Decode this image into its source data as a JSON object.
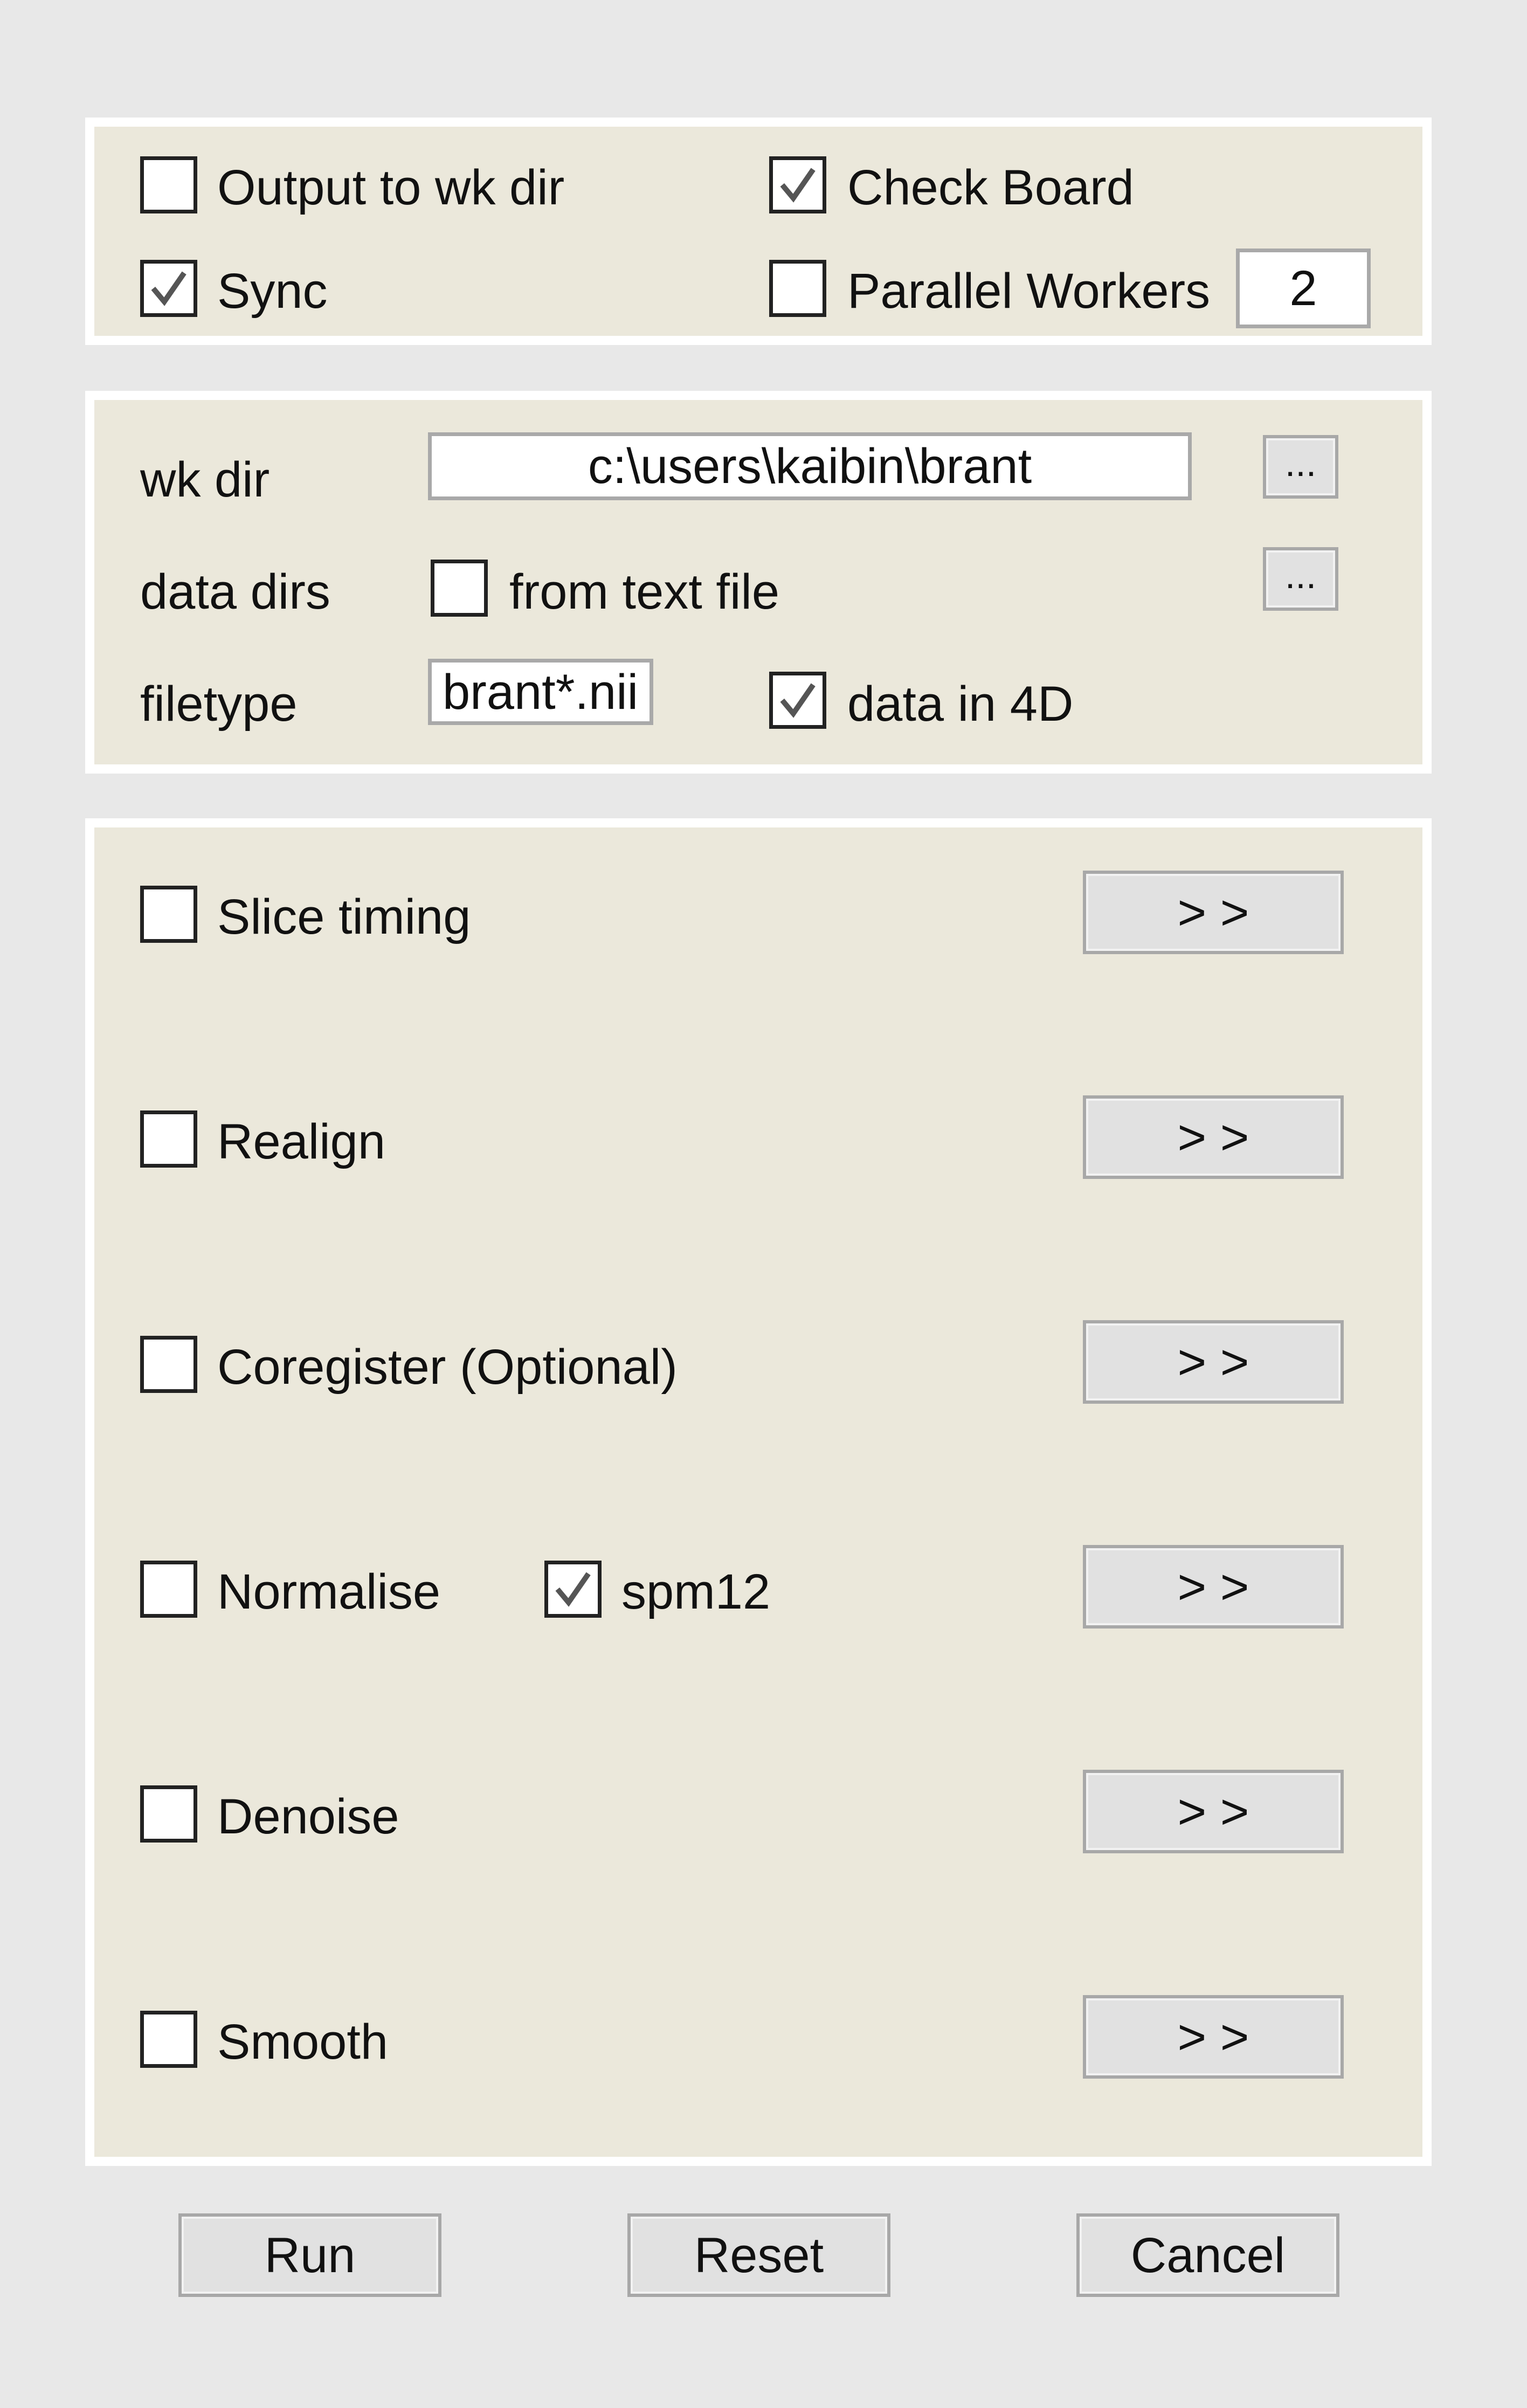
{
  "options": {
    "output_to_wk_dir": {
      "label": "Output to wk dir",
      "checked": false
    },
    "check_board": {
      "label": "Check Board",
      "checked": true
    },
    "sync": {
      "label": "Sync",
      "checked": true
    },
    "parallel_workers": {
      "label": "Parallel Workers",
      "checked": false,
      "value": "2"
    }
  },
  "input": {
    "wk_dir_label": "wk dir",
    "wk_dir_value": "c:\\users\\kaibin\\brant",
    "browse_label": "...",
    "data_dirs_label": "data dirs",
    "from_text_file": {
      "label": "from text file",
      "checked": false
    },
    "filetype_label": "filetype",
    "filetype_value": "brant*.nii",
    "data_in_4d": {
      "label": "data in 4D",
      "checked": true
    }
  },
  "steps": [
    {
      "label": "Slice timing",
      "checked": false,
      "button": "> >"
    },
    {
      "label": "Realign",
      "checked": false,
      "button": "> >"
    },
    {
      "label": "Coregister (Optional)",
      "checked": false,
      "button": "> >"
    },
    {
      "label": "Normalise",
      "checked": false,
      "button": "> >",
      "extra": {
        "label": "spm12",
        "checked": true
      }
    },
    {
      "label": "Denoise",
      "checked": false,
      "button": "> >"
    },
    {
      "label": "Smooth",
      "checked": false,
      "button": "> >"
    }
  ],
  "actions": {
    "run": "Run",
    "reset": "Reset",
    "cancel": "Cancel"
  },
  "colors": {
    "panel": "#ebe8db",
    "background": "#e8e8e8",
    "button": "#e1e1e1"
  }
}
